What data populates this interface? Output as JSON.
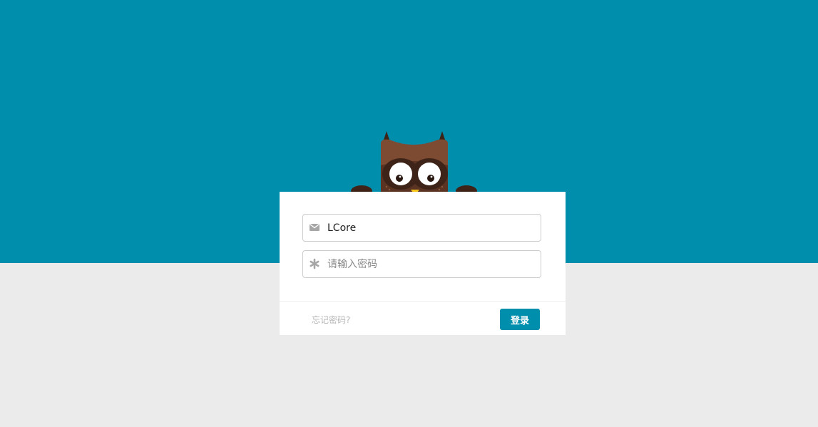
{
  "colors": {
    "brand": "#008ead",
    "page_background": "#ebebeb",
    "card_background": "#ffffff"
  },
  "login_form": {
    "username": {
      "icon": "envelope-icon",
      "value": "LCore"
    },
    "password": {
      "icon": "asterisk-icon",
      "placeholder": "请输入密码"
    },
    "forgot_password_label": "忘记密码?",
    "login_button_label": "登录"
  }
}
